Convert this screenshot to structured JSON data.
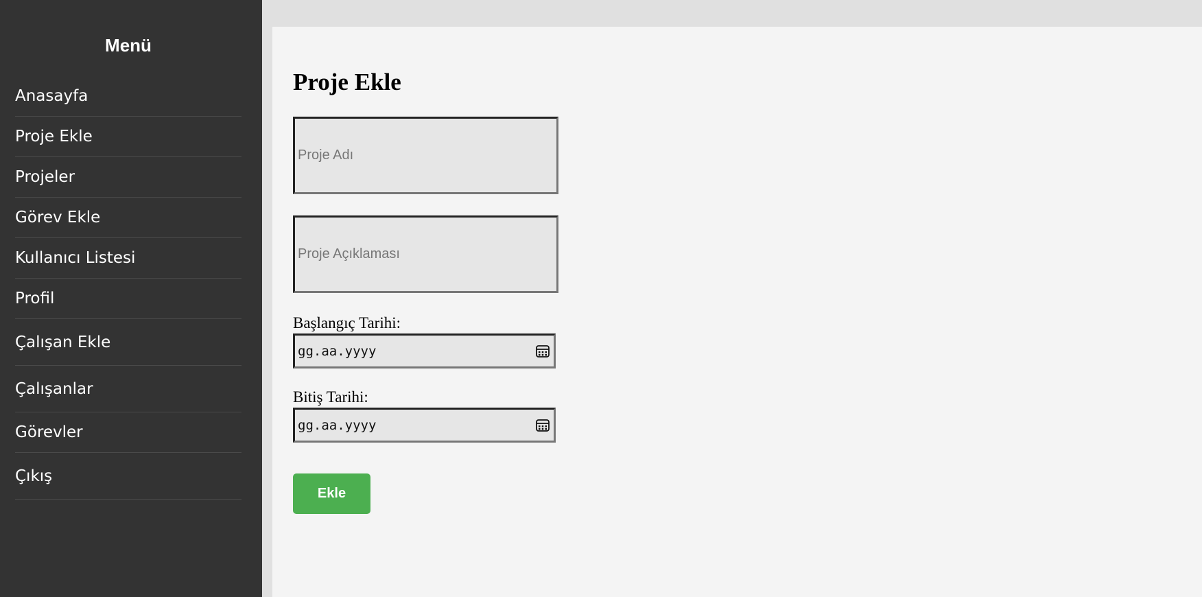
{
  "sidebar": {
    "title": "Menü",
    "items": [
      {
        "label": "Anasayfa"
      },
      {
        "label": "Proje Ekle"
      },
      {
        "label": "Projeler"
      },
      {
        "label": "Görev Ekle"
      },
      {
        "label": "Kullanıcı Listesi"
      },
      {
        "label": "Profil"
      },
      {
        "label": "Çalışan Ekle"
      },
      {
        "label": "Çalışanlar"
      },
      {
        "label": "Görevler"
      },
      {
        "label": "Çıkış"
      }
    ]
  },
  "form": {
    "title": "Proje Ekle",
    "project_name_placeholder": "Proje Adı",
    "project_description_placeholder": "Proje Açıklaması",
    "start_date_label": "Başlangıç Tarihi:",
    "start_date_value": "gg.aa.yyyy",
    "end_date_label": "Bitiş Tarihi:",
    "end_date_value": "gg.aa.yyyy",
    "submit_label": "Ekle"
  },
  "colors": {
    "sidebar_bg": "#333333",
    "content_bg": "#f4f4f4",
    "accent_green": "#4caf50"
  }
}
